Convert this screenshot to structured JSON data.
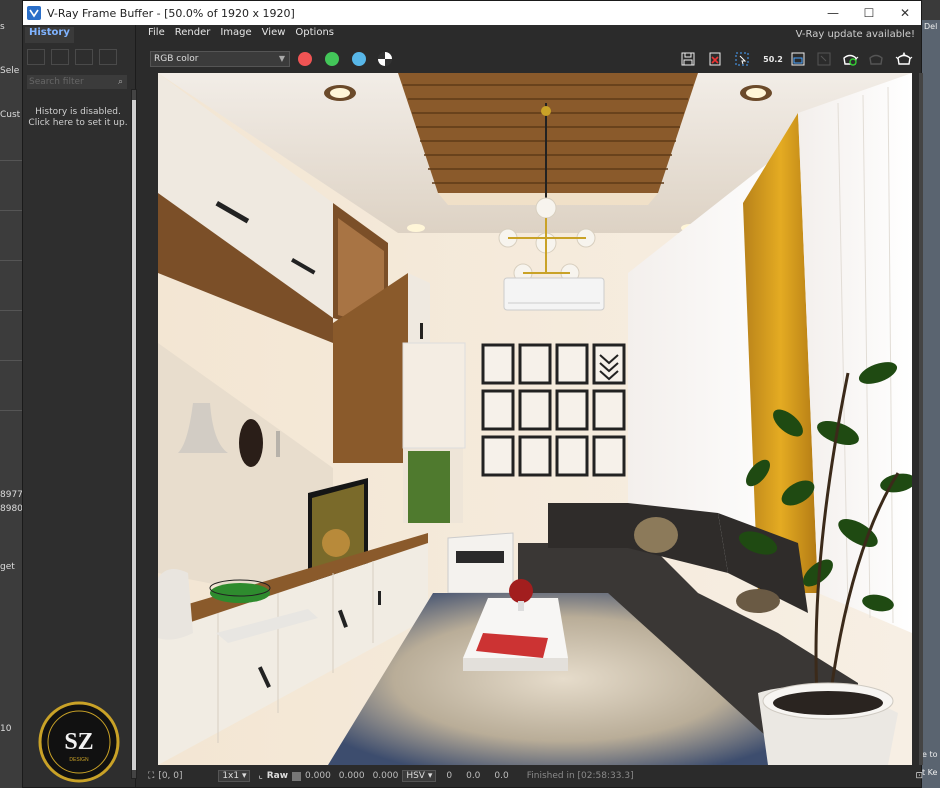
{
  "background_app": {
    "left_labels": [
      "s",
      "Sele",
      "Cust",
      "8977",
      "8980",
      "get",
      "10"
    ],
    "right_labels": [
      "Del",
      "e to K",
      "t Ke"
    ]
  },
  "window": {
    "title": "V-Ray Frame Buffer - [50.0% of 1920 x 1920]",
    "controls": {
      "minimize": "—",
      "maximize": "☐",
      "close": "✕"
    }
  },
  "history": {
    "tab_label": "History",
    "search_placeholder": "Search filter",
    "message_line1": "History is disabled.",
    "message_line2": "Click here to set it up."
  },
  "menu": {
    "items": [
      "File",
      "Render",
      "Image",
      "View",
      "Options"
    ],
    "update_notice": "V-Ray update available!"
  },
  "toolbar": {
    "channel": "RGB color",
    "channel_dots": {
      "red": "#f05454",
      "green": "#43c659",
      "blue": "#58b7e8"
    },
    "zoom_label": "50.2",
    "icons": [
      "save-icon",
      "clear-icon",
      "region-render-icon",
      "zoom-icon",
      "frame-icon",
      "ipr-icon",
      "render-teapot-icon",
      "stop-render-icon",
      "teapot-icon"
    ]
  },
  "status": {
    "coords": "[0, 0]",
    "sampling": "1x1",
    "raw_label": "Raw",
    "raw_values": [
      "0.000",
      "0.000",
      "0.000"
    ],
    "color_mode": "HSV",
    "hsv_values": [
      "0",
      "0.0",
      "0.0"
    ],
    "finished": "Finished in [02:58:33.3]"
  },
  "logo": {
    "text": "SZ",
    "subtext": "DESIGN"
  },
  "colors": {
    "accent_blue": "#2a6fc9",
    "curtain_yellow": "#d9a21e",
    "wood": "#8a5a2b",
    "sofa": "#3a3735"
  }
}
